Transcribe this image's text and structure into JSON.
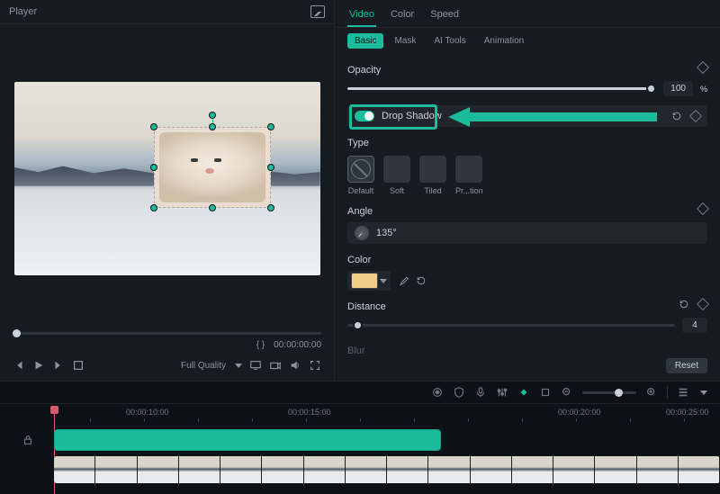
{
  "player": {
    "title": "Player",
    "brace": "{  }",
    "timecode": "00:00:00:00",
    "quality": "Full Quality"
  },
  "tabs": {
    "video": "Video",
    "color": "Color",
    "speed": "Speed"
  },
  "subtabs": {
    "basic": "Basic",
    "mask": "Mask",
    "aitools": "AI Tools",
    "animation": "Animation"
  },
  "opacity": {
    "label": "Opacity",
    "value": "100",
    "unit": "%"
  },
  "dropshadow": {
    "label": "Drop Shadow"
  },
  "type": {
    "label": "Type",
    "default": "Default",
    "soft": "Soft",
    "tiled": "Tiled",
    "projection": "Pr...tion"
  },
  "angle": {
    "label": "Angle",
    "value": "135°"
  },
  "color": {
    "label": "Color",
    "hex": "#f0d088"
  },
  "distance": {
    "label": "Distance",
    "value": "4"
  },
  "blur": {
    "label": "Blur"
  },
  "reset": "Reset",
  "timeline": {
    "t1": "00:00:10:00",
    "t2": "00:00:15:00",
    "t3": "00:00:20:00",
    "t4": "00:00:25:00"
  }
}
